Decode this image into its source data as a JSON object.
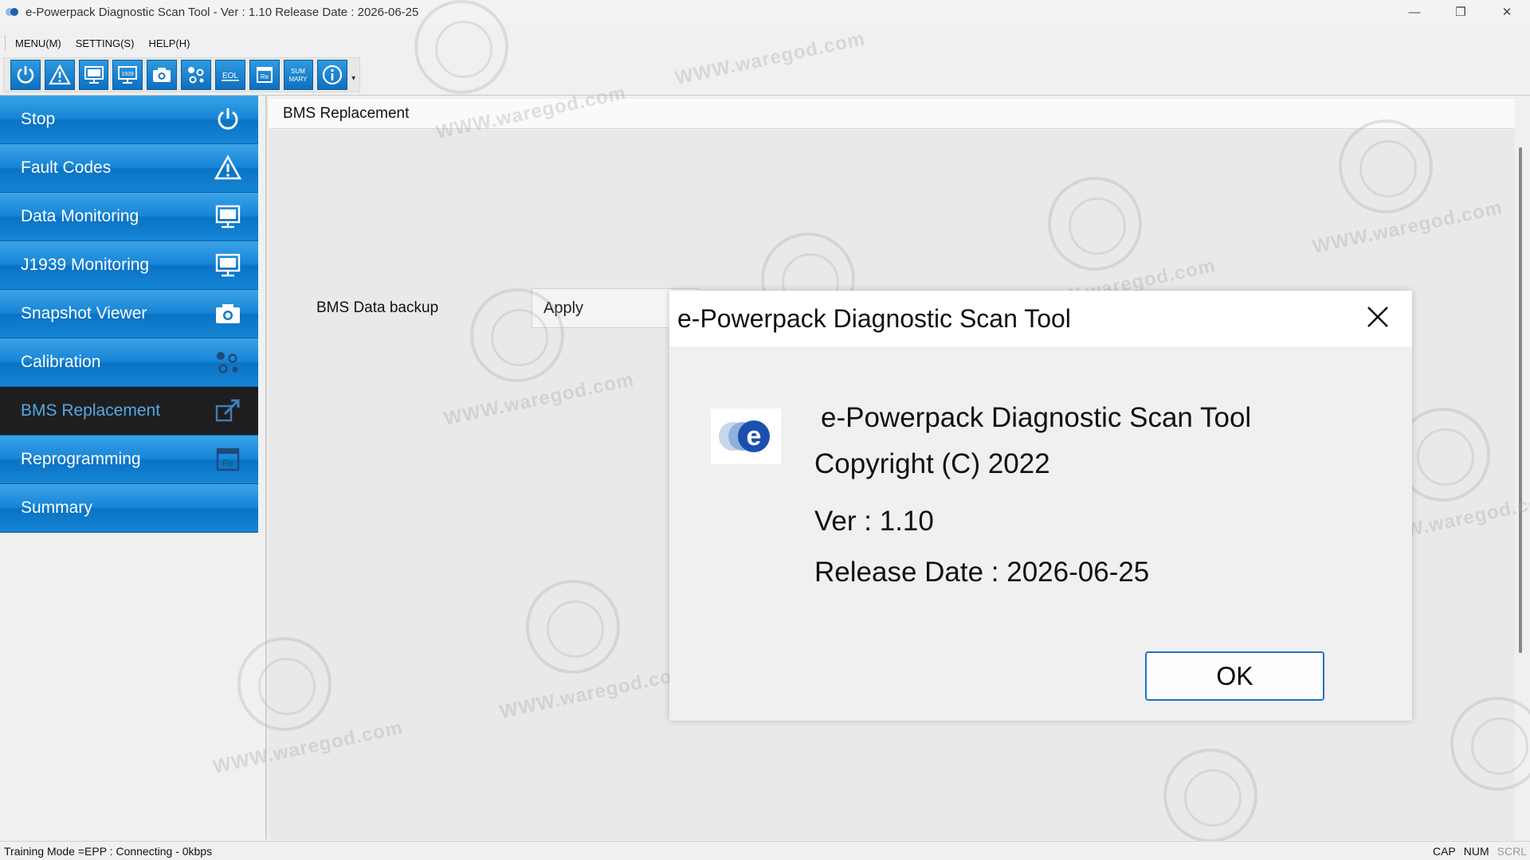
{
  "window": {
    "title": "e-Powerpack Diagnostic Scan Tool - Ver : 1.10 Release Date : 2026-06-25",
    "controls": [
      "—",
      "❐",
      "✕"
    ]
  },
  "menu": [
    {
      "label": "MENU(M)"
    },
    {
      "label": "SETTING(S)"
    },
    {
      "label": "HELP(H)"
    }
  ],
  "toolbar": {
    "buttons": [
      {
        "icon": "power-icon"
      },
      {
        "icon": "warning-icon"
      },
      {
        "icon": "monitor-icon"
      },
      {
        "icon": "j1939-monitor-icon",
        "text": "1939"
      },
      {
        "icon": "camera-icon"
      },
      {
        "icon": "calibration-icon"
      },
      {
        "icon": "eol-icon",
        "text": "EOL"
      },
      {
        "icon": "reprogram-icon",
        "text": "Re"
      },
      {
        "icon": "summary-icon",
        "text": "SUM\nMARY"
      },
      {
        "icon": "info-icon"
      }
    ]
  },
  "sidebar": {
    "items": [
      {
        "label": "Stop",
        "icon": "power-icon"
      },
      {
        "label": "Fault Codes",
        "icon": "warning-icon"
      },
      {
        "label": "Data Monitoring",
        "icon": "monitor-icon"
      },
      {
        "label": "J1939 Monitoring",
        "icon": "monitor-icon"
      },
      {
        "label": "Snapshot Viewer",
        "icon": "camera-icon"
      },
      {
        "label": "Calibration",
        "icon": "calibration-icon"
      },
      {
        "label": "BMS Replacement",
        "icon": "replace-icon",
        "active": true
      },
      {
        "label": "Reprogramming",
        "icon": "reprogram-icon"
      },
      {
        "label": "Summary",
        "icon": ""
      }
    ]
  },
  "panel": {
    "title": "BMS Replacement",
    "backup_label": "BMS Data backup",
    "apply_label": "Apply"
  },
  "dialog": {
    "title": "e-Powerpack Diagnostic Scan Tool",
    "app_name": "e-Powerpack Diagnostic Scan Tool",
    "copyright": "Copyright (C) 2022",
    "version": "Ver : 1.10",
    "release_date": "Release Date : 2026-06-25",
    "ok_label": "OK",
    "logo_letter": "e"
  },
  "status": {
    "text": "Training Mode =EPP : Connecting - 0kbps",
    "indicators": [
      "CAP",
      "NUM",
      "SCRL"
    ]
  },
  "watermark": {
    "text": "WWW.waregod.com"
  },
  "colors": {
    "sidebar_blue": "#1785d6",
    "sidebar_active_bg": "#1e1e1e",
    "sidebar_active_text": "#52a8e8",
    "ok_border": "#1a73c8"
  }
}
